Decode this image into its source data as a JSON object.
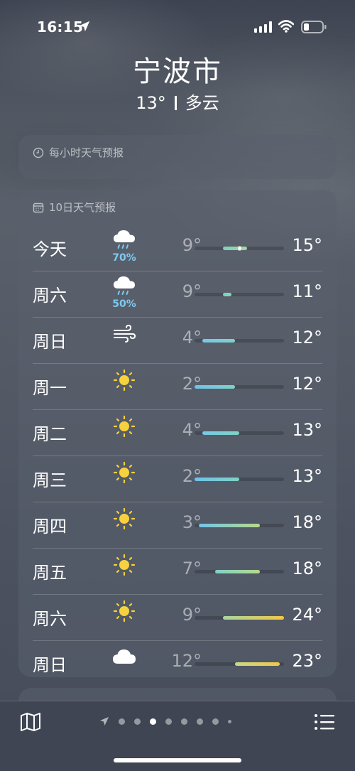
{
  "status_bar": {
    "time": "16:15"
  },
  "header": {
    "city": "宁波市",
    "temp": "13°",
    "condition": "多云"
  },
  "hourly_card": {
    "title": "每小时天气预报"
  },
  "daily_card": {
    "title": "10日天气预报",
    "range": [
      2,
      24
    ],
    "days": [
      {
        "day": "今天",
        "icon": "rain-cloud-icon",
        "precip": "70%",
        "low": "9°",
        "high": "15°",
        "low_val": 9,
        "high_val": 15,
        "current": 13,
        "colors": [
          "#7fd1b9",
          "#9ed9a0"
        ]
      },
      {
        "day": "周六",
        "icon": "rain-cloud-icon",
        "precip": "50%",
        "low": "9°",
        "high": "11°",
        "low_val": 9,
        "high_val": 11,
        "colors": [
          "#7fd1c0",
          "#86d6b8"
        ]
      },
      {
        "day": "周日",
        "icon": "wind-icon",
        "precip": "",
        "low": "4°",
        "high": "12°",
        "low_val": 4,
        "high_val": 12,
        "colors": [
          "#77c8e6",
          "#7fd1c9"
        ]
      },
      {
        "day": "周一",
        "icon": "sun-icon",
        "precip": "",
        "low": "2°",
        "high": "12°",
        "low_val": 2,
        "high_val": 12,
        "colors": [
          "#6ec2ea",
          "#7fd1c9"
        ]
      },
      {
        "day": "周二",
        "icon": "sun-icon",
        "precip": "",
        "low": "4°",
        "high": "13°",
        "low_val": 4,
        "high_val": 13,
        "colors": [
          "#77c8e6",
          "#80d2c6"
        ]
      },
      {
        "day": "周三",
        "icon": "sun-icon",
        "precip": "",
        "low": "2°",
        "high": "13°",
        "low_val": 2,
        "high_val": 13,
        "colors": [
          "#6ec2ea",
          "#80d2c6"
        ]
      },
      {
        "day": "周四",
        "icon": "sun-icon",
        "precip": "",
        "low": "3°",
        "high": "18°",
        "low_val": 3,
        "high_val": 18,
        "colors": [
          "#72c5e8",
          "#b7d98c"
        ]
      },
      {
        "day": "周五",
        "icon": "sun-icon",
        "precip": "",
        "low": "7°",
        "high": "18°",
        "low_val": 7,
        "high_val": 18,
        "colors": [
          "#7fd1c9",
          "#b7d98c"
        ]
      },
      {
        "day": "周六",
        "icon": "sun-icon",
        "precip": "",
        "low": "9°",
        "high": "24°",
        "low_val": 9,
        "high_val": 24,
        "colors": [
          "#a7d7a0",
          "#f2c744"
        ]
      },
      {
        "day": "周日",
        "icon": "cloud-icon",
        "precip": "",
        "low": "12°",
        "high": "23°",
        "low_val": 12,
        "high_val": 23,
        "colors": [
          "#c8d98a",
          "#f2c744"
        ]
      }
    ]
  },
  "page_indicator": {
    "count": 8,
    "active": 2
  }
}
